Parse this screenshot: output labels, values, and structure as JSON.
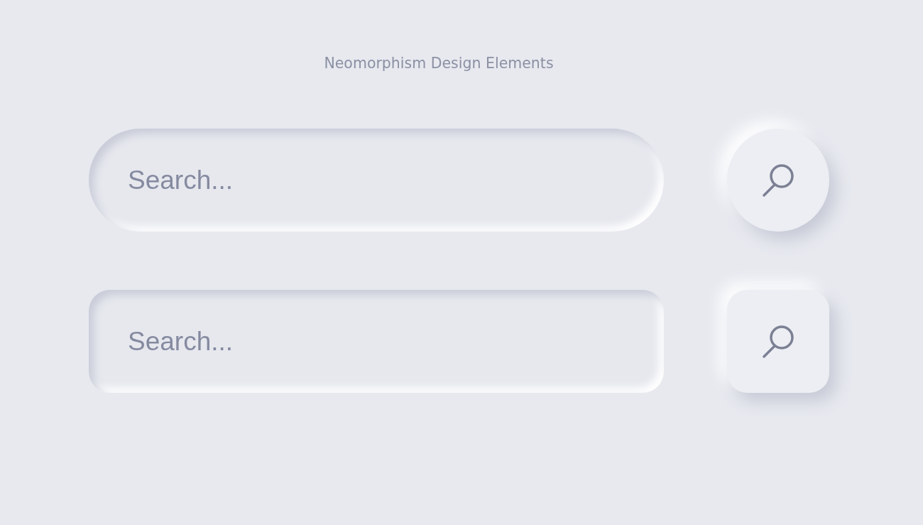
{
  "title": "Neomorphism Design Elements",
  "search_bars": [
    {
      "kind": "pill",
      "placeholder": "Search..."
    },
    {
      "kind": "rounded",
      "placeholder": "Search..."
    }
  ]
}
